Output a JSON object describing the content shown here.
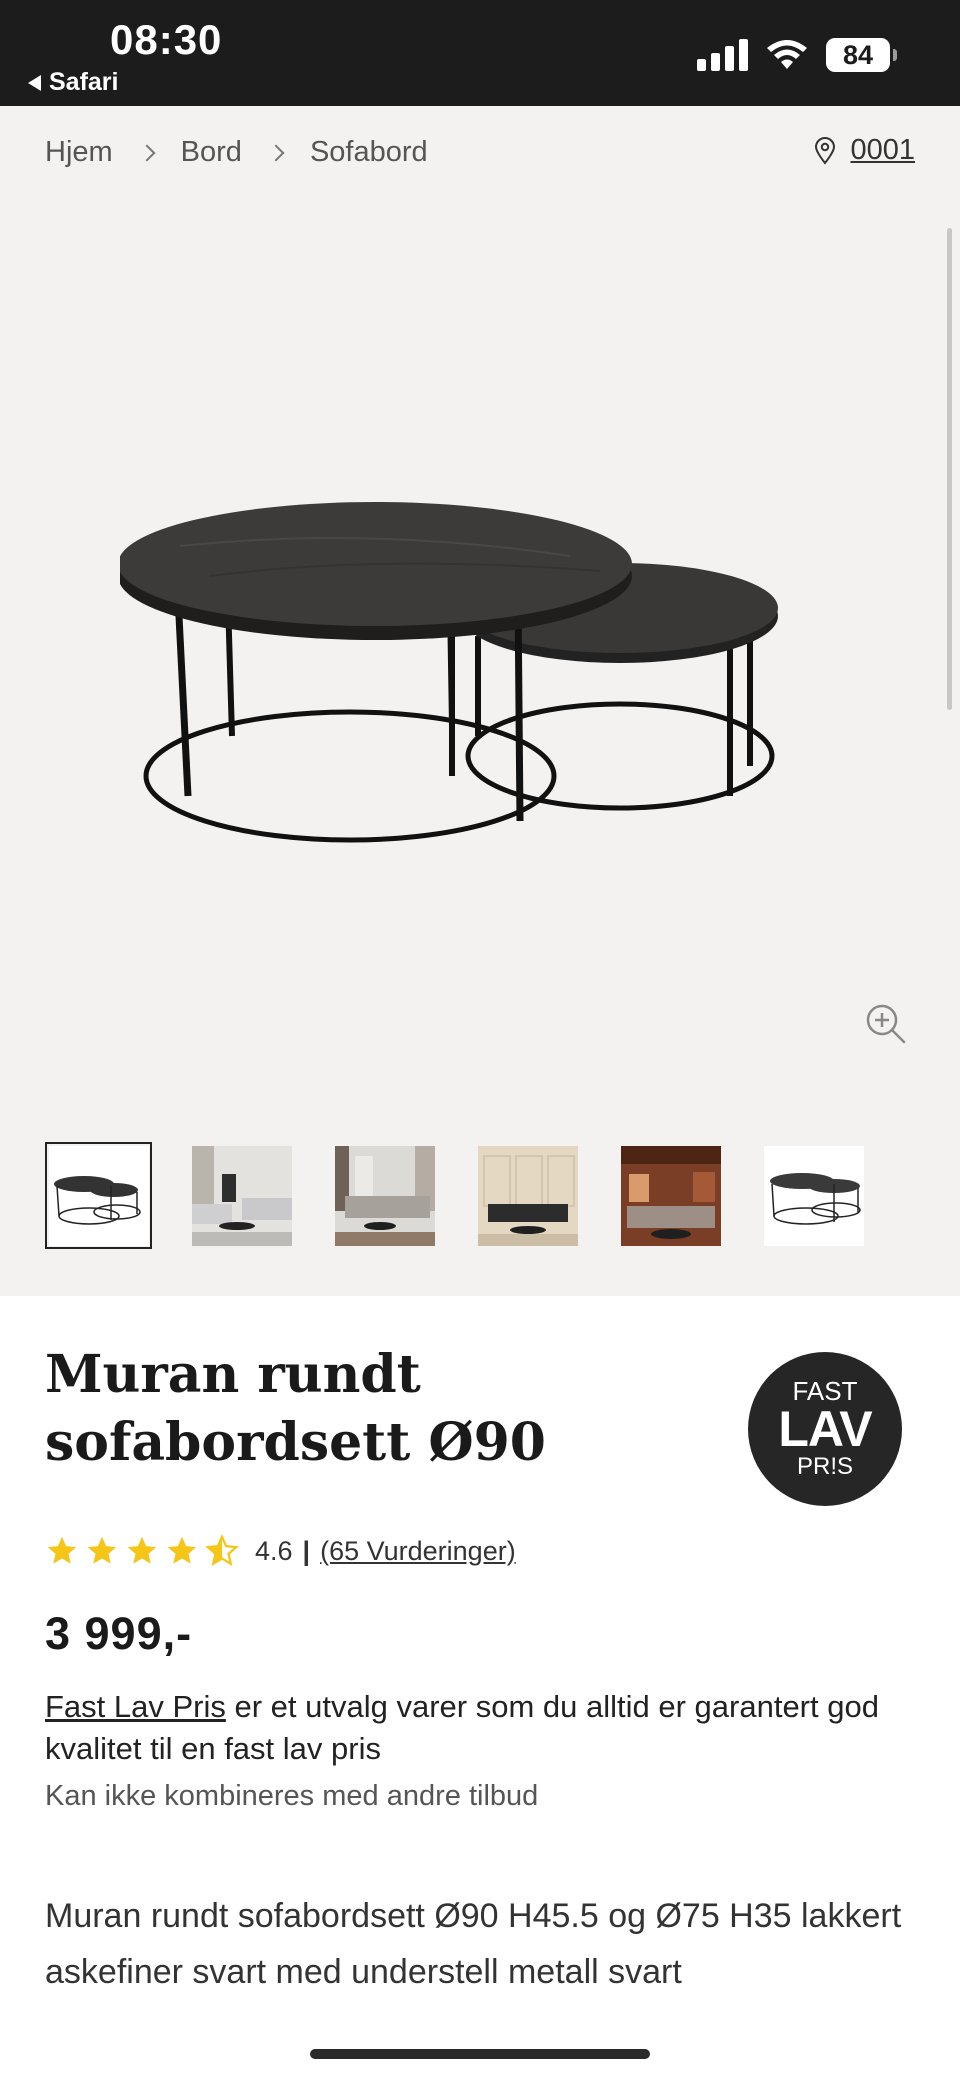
{
  "status_bar": {
    "time": "08:30",
    "back_label": "Safari",
    "battery": "84"
  },
  "breadcrumb": {
    "items": [
      "Hjem",
      "Bord",
      "Sofabord"
    ]
  },
  "location": {
    "code": "0001"
  },
  "product": {
    "title": "Muran rundt sofabordsett Ø90",
    "badge": {
      "line1": "FAST",
      "line2": "LAV",
      "line3": "PR!S"
    },
    "rating": {
      "score": "4.6",
      "reviews": "(65 Vurderinger)",
      "stars_value": 4.5
    },
    "price": "3 999,-",
    "promo_link": "Fast Lav Pris",
    "promo_text": " er et utvalg varer som du alltid er garantert god kvalitet til en fast lav pris",
    "note": "Kan ikke kombineres med andre tilbud",
    "description": "Muran rundt sofabordsett Ø90 H45.5 og Ø75 H35 lakkert askefiner svart med understell metall svart"
  },
  "colors": {
    "star": "#f5c518",
    "badge_bg": "#262626",
    "gallery_bg": "#f3f2f0"
  }
}
